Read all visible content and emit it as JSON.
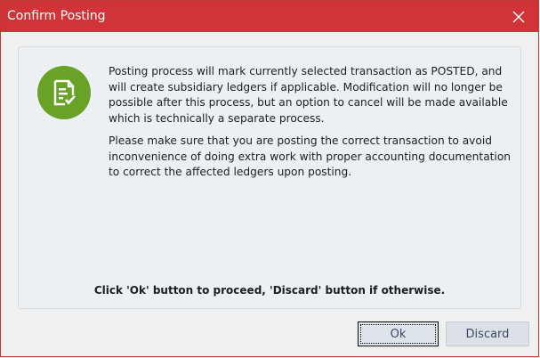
{
  "dialog": {
    "title": "Confirm Posting",
    "close_icon": "close-icon",
    "status_icon": "document-check-icon",
    "accent_color": "#d13438",
    "icon_color": "#6aa127",
    "message_paragraphs": [
      "Posting process will mark currently selected transaction as POSTED, and will create subsidiary ledgers if applicable. Modification will no longer be possible after this process, but an option to cancel will be made available which is technically a separate process.",
      "Please make sure that you are posting the correct transaction to avoid inconvenience of doing extra work with proper accounting documentation to correct the affected ledgers upon posting."
    ],
    "instruction": "Click 'Ok' button to proceed, 'Discard' button if otherwise.",
    "buttons": {
      "ok_label": "Ok",
      "discard_label": "Discard"
    }
  }
}
